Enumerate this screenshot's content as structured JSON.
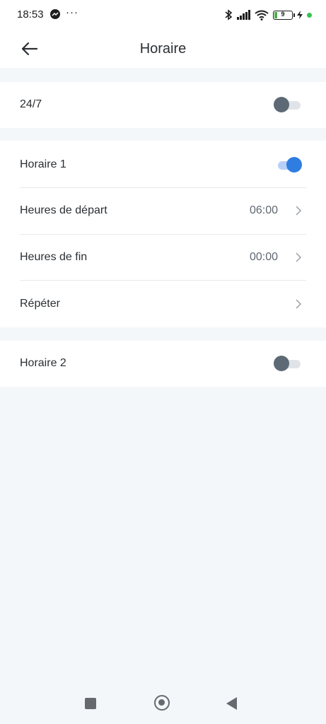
{
  "status_bar": {
    "time": "18:53",
    "battery_level": "9",
    "icons": [
      "messenger-icon",
      "more-icon",
      "bluetooth-icon",
      "signal-icon",
      "wifi-icon",
      "battery-icon",
      "charging-icon"
    ]
  },
  "header": {
    "title": "Horaire",
    "back_icon": "arrow-left-icon"
  },
  "always_on": {
    "label": "24/7",
    "enabled": false
  },
  "schedule1": {
    "label": "Horaire 1",
    "enabled": true,
    "start": {
      "label": "Heures de départ",
      "value": "06:00"
    },
    "end": {
      "label": "Heures de fin",
      "value": "00:00"
    },
    "repeat": {
      "label": "Répéter"
    }
  },
  "schedule2": {
    "label": "Horaire 2",
    "enabled": false
  },
  "colors": {
    "accent": "#2f7de1",
    "toggle_off_knob": "#5d6a75",
    "background": "#f4f7f9"
  }
}
